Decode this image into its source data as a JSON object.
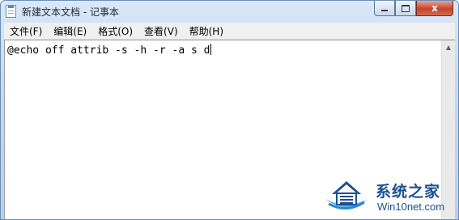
{
  "window": {
    "title": "新建文本文档 - 记事本",
    "app_icon": "notepad-icon",
    "controls": {
      "minimize_icon": "minimize-icon",
      "maximize_icon": "maximize-icon",
      "close_icon": "close-icon",
      "close_glyph": "x"
    },
    "colors": {
      "titlebar": "#c4d9ef",
      "close_button": "#c4442b",
      "watermark": "#1a4f93"
    }
  },
  "menu": {
    "items": [
      {
        "label": "文件(F)"
      },
      {
        "label": "编辑(E)"
      },
      {
        "label": "格式(O)"
      },
      {
        "label": "查看(V)"
      },
      {
        "label": "帮助(H)"
      }
    ]
  },
  "editor": {
    "content": "@echo off attrib -s -h -r -a s d",
    "scroll_up_icon": "scroll-up-arrow-icon"
  },
  "watermark": {
    "title": "系统之家",
    "url": "Win10net.com",
    "logo_icon": "house-logo-icon"
  }
}
